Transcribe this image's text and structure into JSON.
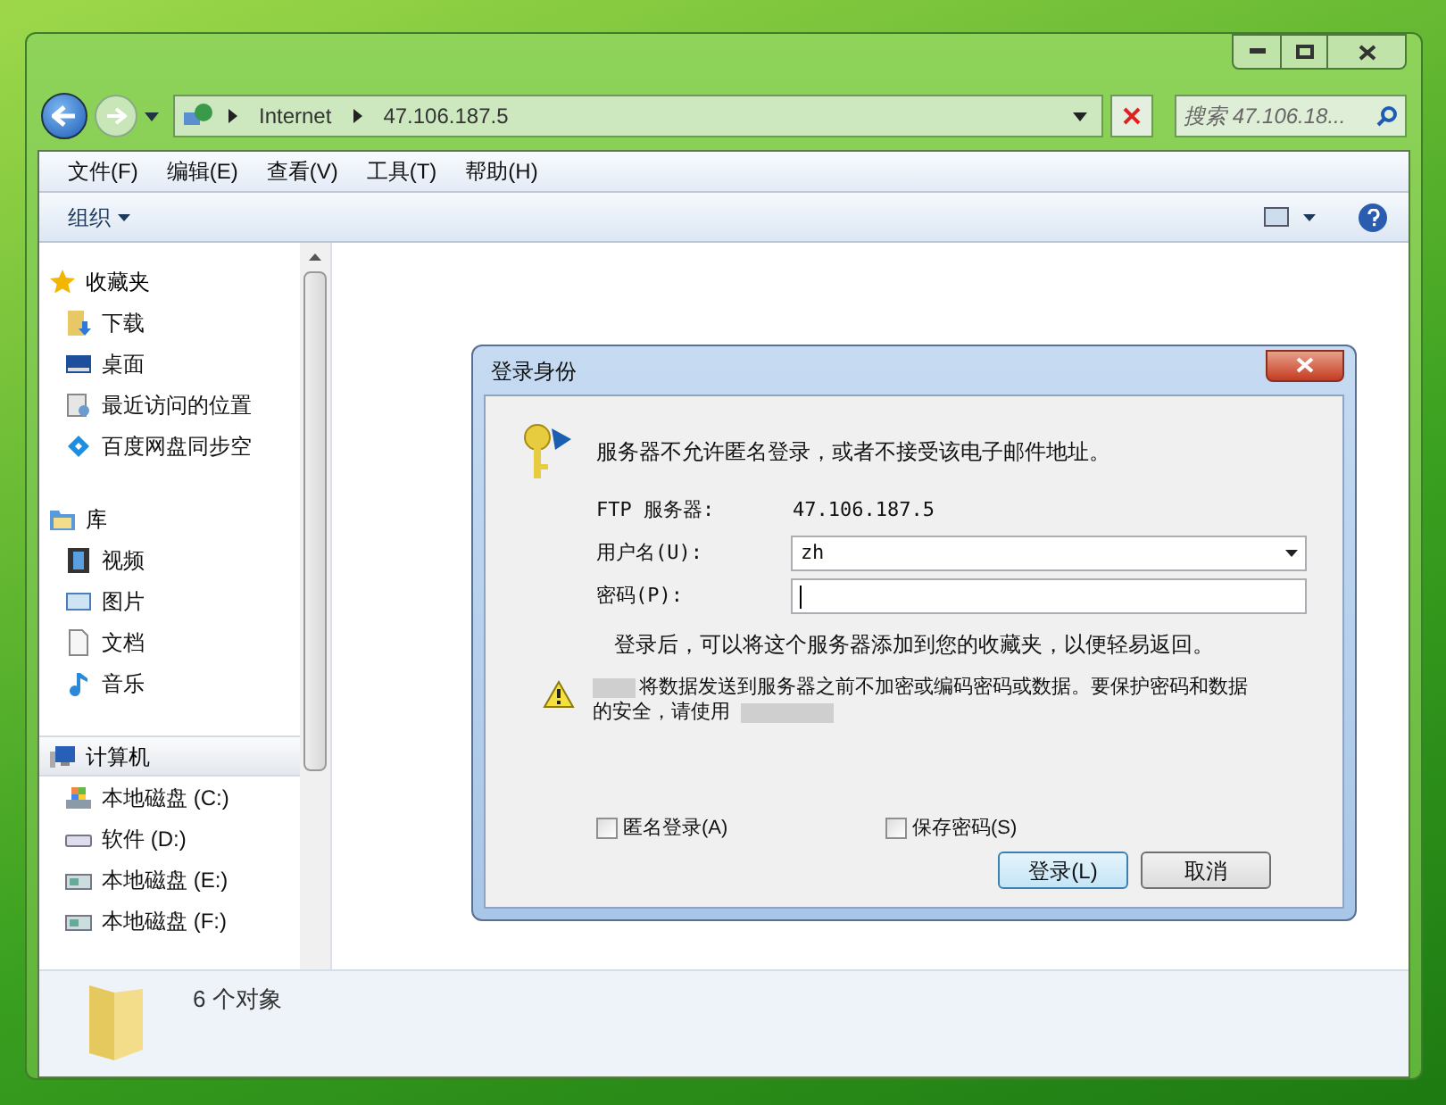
{
  "address_bar": {
    "segments": [
      "Internet",
      "47.106.187.5"
    ]
  },
  "search": {
    "placeholder": "搜索 47.106.18..."
  },
  "menu": [
    "文件(F)",
    "编辑(E)",
    "查看(V)",
    "工具(T)",
    "帮助(H)"
  ],
  "toolbar": {
    "organize": "组织"
  },
  "sidebar": {
    "groups": [
      {
        "label": "收藏夹",
        "kind": "star",
        "selected": false,
        "children": [
          {
            "label": "下载",
            "kind": "download"
          },
          {
            "label": "桌面",
            "kind": "desktop"
          },
          {
            "label": "最近访问的位置",
            "kind": "recent"
          },
          {
            "label": "百度网盘同步空",
            "kind": "cloud"
          }
        ]
      },
      {
        "label": "库",
        "kind": "library",
        "selected": false,
        "children": [
          {
            "label": "视频",
            "kind": "video"
          },
          {
            "label": "图片",
            "kind": "image"
          },
          {
            "label": "文档",
            "kind": "document"
          },
          {
            "label": "音乐",
            "kind": "music"
          }
        ]
      },
      {
        "label": "计算机",
        "kind": "computer",
        "selected": true,
        "children": [
          {
            "label": "本地磁盘 (C:)",
            "kind": "system-drive"
          },
          {
            "label": "软件 (D:)",
            "kind": "drive"
          },
          {
            "label": "本地磁盘 (E:)",
            "kind": "unknown-drive"
          },
          {
            "label": "本地磁盘 (F:)",
            "kind": "unknown-drive"
          }
        ]
      }
    ]
  },
  "status_bar": {
    "count": "6 个对象"
  },
  "dialog": {
    "title": "登录身份",
    "message": "服务器不允许匿名登录，或者不接受该电子邮件地址。",
    "fields": [
      {
        "label": "FTP 服务器:",
        "kind": "text",
        "value": "47.106.187.5"
      },
      {
        "label": "用户名(U):",
        "kind": "combo",
        "value": "zh"
      },
      {
        "label": "密码(P):",
        "kind": "password"
      }
    ],
    "hint": "登录后，可以将这个服务器添加到您的收藏夹，以便轻易返回。",
    "warning": [
      "将数据发送到服务器之前不加密或编码密码或数据。要保护密码和数据",
      "的安全，请使用"
    ],
    "checkboxes": [
      {
        "label": "匿名登录(A)",
        "checked": false
      },
      {
        "label": "保存密码(S)",
        "checked": false
      }
    ],
    "buttons": [
      {
        "label": "登录(L)",
        "default": true
      },
      {
        "label": "取消",
        "default": false
      }
    ]
  }
}
